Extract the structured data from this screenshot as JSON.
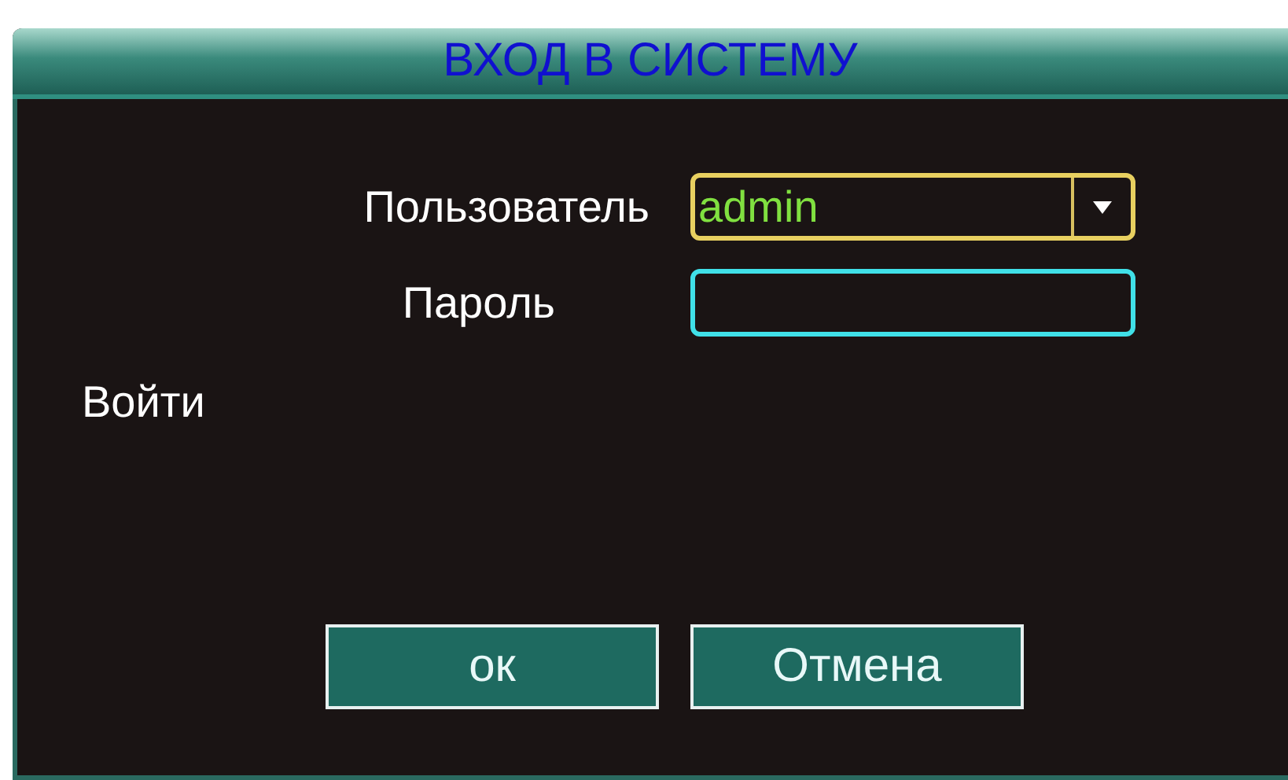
{
  "window": {
    "title": "ВХОД В СИСТЕМУ"
  },
  "fields": [
    {
      "label": "Пользователь",
      "kind": "dropdown",
      "value": "admin",
      "focused": true
    },
    {
      "label": "Пароль",
      "kind": "password",
      "focused": false
    }
  ],
  "status": "Войти",
  "buttons": [
    "ок",
    "Отмена"
  ]
}
